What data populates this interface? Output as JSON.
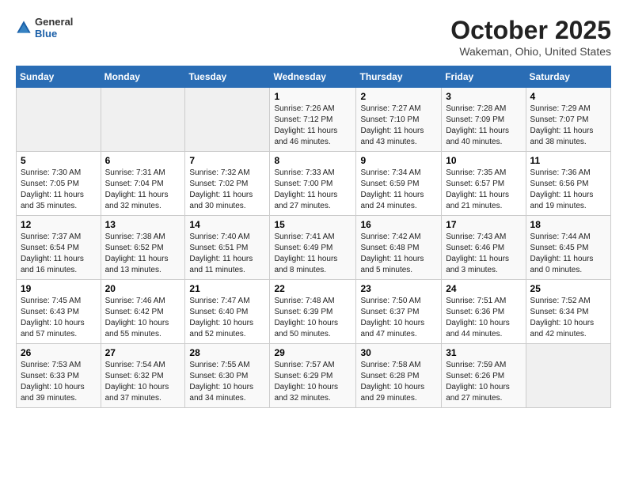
{
  "header": {
    "logo_general": "General",
    "logo_blue": "Blue",
    "month_title": "October 2025",
    "location": "Wakeman, Ohio, United States"
  },
  "days_of_week": [
    "Sunday",
    "Monday",
    "Tuesday",
    "Wednesday",
    "Thursday",
    "Friday",
    "Saturday"
  ],
  "weeks": [
    [
      {
        "day": "",
        "empty": true
      },
      {
        "day": "",
        "empty": true
      },
      {
        "day": "",
        "empty": true
      },
      {
        "day": "1",
        "sunrise": "7:26 AM",
        "sunset": "7:12 PM",
        "daylight": "11 hours and 46 minutes."
      },
      {
        "day": "2",
        "sunrise": "7:27 AM",
        "sunset": "7:10 PM",
        "daylight": "11 hours and 43 minutes."
      },
      {
        "day": "3",
        "sunrise": "7:28 AM",
        "sunset": "7:09 PM",
        "daylight": "11 hours and 40 minutes."
      },
      {
        "day": "4",
        "sunrise": "7:29 AM",
        "sunset": "7:07 PM",
        "daylight": "11 hours and 38 minutes."
      }
    ],
    [
      {
        "day": "5",
        "sunrise": "7:30 AM",
        "sunset": "7:05 PM",
        "daylight": "11 hours and 35 minutes."
      },
      {
        "day": "6",
        "sunrise": "7:31 AM",
        "sunset": "7:04 PM",
        "daylight": "11 hours and 32 minutes."
      },
      {
        "day": "7",
        "sunrise": "7:32 AM",
        "sunset": "7:02 PM",
        "daylight": "11 hours and 30 minutes."
      },
      {
        "day": "8",
        "sunrise": "7:33 AM",
        "sunset": "7:00 PM",
        "daylight": "11 hours and 27 minutes."
      },
      {
        "day": "9",
        "sunrise": "7:34 AM",
        "sunset": "6:59 PM",
        "daylight": "11 hours and 24 minutes."
      },
      {
        "day": "10",
        "sunrise": "7:35 AM",
        "sunset": "6:57 PM",
        "daylight": "11 hours and 21 minutes."
      },
      {
        "day": "11",
        "sunrise": "7:36 AM",
        "sunset": "6:56 PM",
        "daylight": "11 hours and 19 minutes."
      }
    ],
    [
      {
        "day": "12",
        "sunrise": "7:37 AM",
        "sunset": "6:54 PM",
        "daylight": "11 hours and 16 minutes."
      },
      {
        "day": "13",
        "sunrise": "7:38 AM",
        "sunset": "6:52 PM",
        "daylight": "11 hours and 13 minutes."
      },
      {
        "day": "14",
        "sunrise": "7:40 AM",
        "sunset": "6:51 PM",
        "daylight": "11 hours and 11 minutes."
      },
      {
        "day": "15",
        "sunrise": "7:41 AM",
        "sunset": "6:49 PM",
        "daylight": "11 hours and 8 minutes."
      },
      {
        "day": "16",
        "sunrise": "7:42 AM",
        "sunset": "6:48 PM",
        "daylight": "11 hours and 5 minutes."
      },
      {
        "day": "17",
        "sunrise": "7:43 AM",
        "sunset": "6:46 PM",
        "daylight": "11 hours and 3 minutes."
      },
      {
        "day": "18",
        "sunrise": "7:44 AM",
        "sunset": "6:45 PM",
        "daylight": "11 hours and 0 minutes."
      }
    ],
    [
      {
        "day": "19",
        "sunrise": "7:45 AM",
        "sunset": "6:43 PM",
        "daylight": "10 hours and 57 minutes."
      },
      {
        "day": "20",
        "sunrise": "7:46 AM",
        "sunset": "6:42 PM",
        "daylight": "10 hours and 55 minutes."
      },
      {
        "day": "21",
        "sunrise": "7:47 AM",
        "sunset": "6:40 PM",
        "daylight": "10 hours and 52 minutes."
      },
      {
        "day": "22",
        "sunrise": "7:48 AM",
        "sunset": "6:39 PM",
        "daylight": "10 hours and 50 minutes."
      },
      {
        "day": "23",
        "sunrise": "7:50 AM",
        "sunset": "6:37 PM",
        "daylight": "10 hours and 47 minutes."
      },
      {
        "day": "24",
        "sunrise": "7:51 AM",
        "sunset": "6:36 PM",
        "daylight": "10 hours and 44 minutes."
      },
      {
        "day": "25",
        "sunrise": "7:52 AM",
        "sunset": "6:34 PM",
        "daylight": "10 hours and 42 minutes."
      }
    ],
    [
      {
        "day": "26",
        "sunrise": "7:53 AM",
        "sunset": "6:33 PM",
        "daylight": "10 hours and 39 minutes."
      },
      {
        "day": "27",
        "sunrise": "7:54 AM",
        "sunset": "6:32 PM",
        "daylight": "10 hours and 37 minutes."
      },
      {
        "day": "28",
        "sunrise": "7:55 AM",
        "sunset": "6:30 PM",
        "daylight": "10 hours and 34 minutes."
      },
      {
        "day": "29",
        "sunrise": "7:57 AM",
        "sunset": "6:29 PM",
        "daylight": "10 hours and 32 minutes."
      },
      {
        "day": "30",
        "sunrise": "7:58 AM",
        "sunset": "6:28 PM",
        "daylight": "10 hours and 29 minutes."
      },
      {
        "day": "31",
        "sunrise": "7:59 AM",
        "sunset": "6:26 PM",
        "daylight": "10 hours and 27 minutes."
      },
      {
        "day": "",
        "empty": true
      }
    ]
  ]
}
